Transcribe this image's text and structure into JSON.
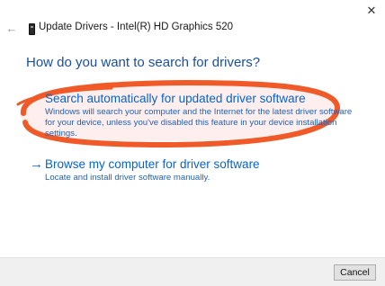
{
  "window": {
    "title": "Update Drivers - Intel(R) HD Graphics 520",
    "back_icon": "back-arrow-icon",
    "close_icon": "close-icon",
    "device_icon": "display-adapter-icon"
  },
  "main": {
    "heading": "How do you want to search for drivers?",
    "options": [
      {
        "title": "Search automatically for updated driver software",
        "description": "Windows will search your computer and the Internet for the latest driver software for your device, unless you've disabled this feature in your device installation settings.",
        "icon": "arrow-right-icon"
      },
      {
        "title": "Browse my computer for driver software",
        "description": "Locate and install driver software manually.",
        "icon": "arrow-right-icon"
      }
    ]
  },
  "footer": {
    "cancel_label": "Cancel"
  },
  "colors": {
    "link": "#0a63c9",
    "heading": "#1a4f9a",
    "annotation_stroke": "#f05a28",
    "annotation_fill": "#fde8e8"
  }
}
